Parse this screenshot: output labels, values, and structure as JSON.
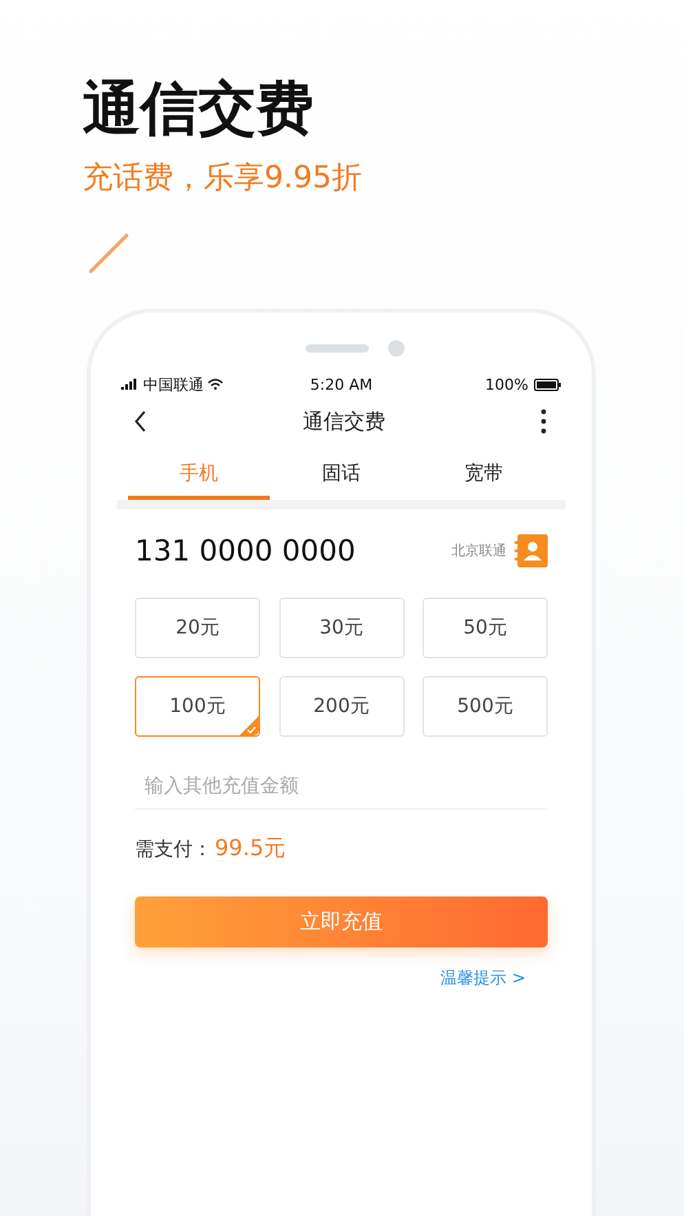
{
  "headline": "通信交费",
  "subtitle": "充话费，乐享9.95折",
  "status_bar": {
    "carrier": "中国联通",
    "time": "5:20 AM",
    "battery": "100%"
  },
  "nav": {
    "title": "通信交费"
  },
  "tabs": [
    {
      "label": "手机",
      "selected": true
    },
    {
      "label": "固话",
      "selected": false
    },
    {
      "label": "宽带",
      "selected": false
    }
  ],
  "phone": {
    "number": "131 0000 0000",
    "operator": "北京联通"
  },
  "amounts": [
    {
      "label": "20元",
      "selected": false
    },
    {
      "label": "30元",
      "selected": false
    },
    {
      "label": "50元",
      "selected": false
    },
    {
      "label": "100元",
      "selected": true
    },
    {
      "label": "200元",
      "selected": false
    },
    {
      "label": "500元",
      "selected": false
    }
  ],
  "custom_amount": {
    "placeholder": "输入其他充值金额"
  },
  "payment": {
    "label": "需支付：",
    "amount": "99.5元"
  },
  "submit_button": "立即充值",
  "tips_link": "温馨提示 >"
}
